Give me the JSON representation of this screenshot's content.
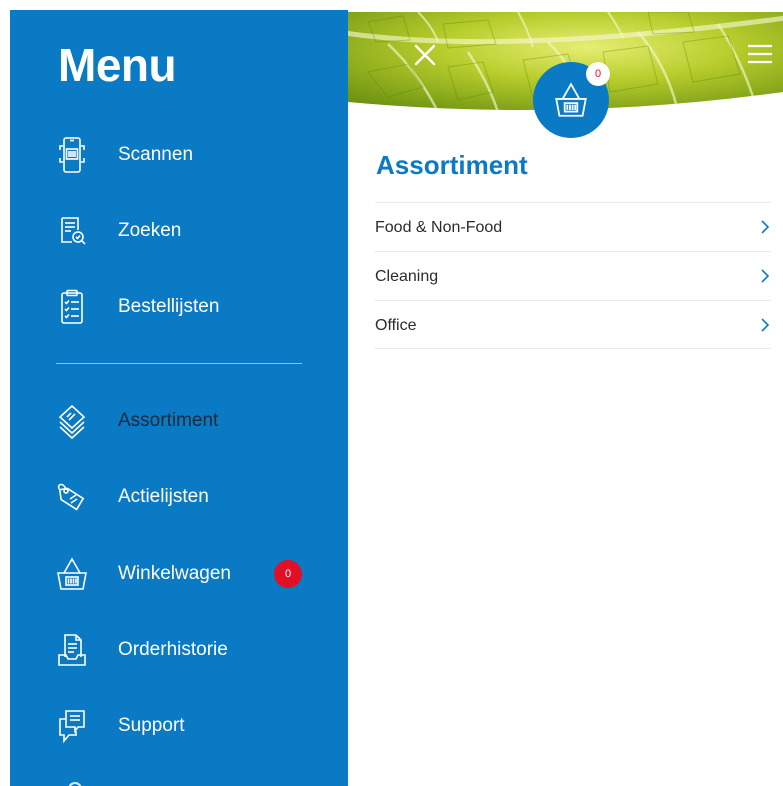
{
  "menu": {
    "title": "Menu",
    "items": [
      {
        "label": "Scannen",
        "icon": "phone-scan-icon"
      },
      {
        "label": "Zoeken",
        "icon": "document-search-icon"
      },
      {
        "label": "Bestellijsten",
        "icon": "clipboard-checklist-icon"
      },
      {
        "label": "Assortiment",
        "icon": "layers-icon",
        "active": true
      },
      {
        "label": "Actielijsten",
        "icon": "price-tag-icon"
      },
      {
        "label": "Winkelwagen",
        "icon": "basket-icon",
        "badge": "0"
      },
      {
        "label": "Orderhistorie",
        "icon": "document-tray-icon"
      },
      {
        "label": "Support",
        "icon": "chat-bubble-icon"
      }
    ]
  },
  "header": {
    "close_icon": "close-icon",
    "menu_icon": "hamburger-icon",
    "cart_icon": "basket-icon",
    "cart_badge": "0"
  },
  "main": {
    "title": "Assortiment",
    "categories": [
      {
        "label": "Food & Non-Food"
      },
      {
        "label": "Cleaning"
      },
      {
        "label": "Office"
      }
    ]
  },
  "colors": {
    "brand_blue": "#0a7ac4",
    "badge_red": "#e30f26",
    "active_text": "#1a2b3c"
  }
}
